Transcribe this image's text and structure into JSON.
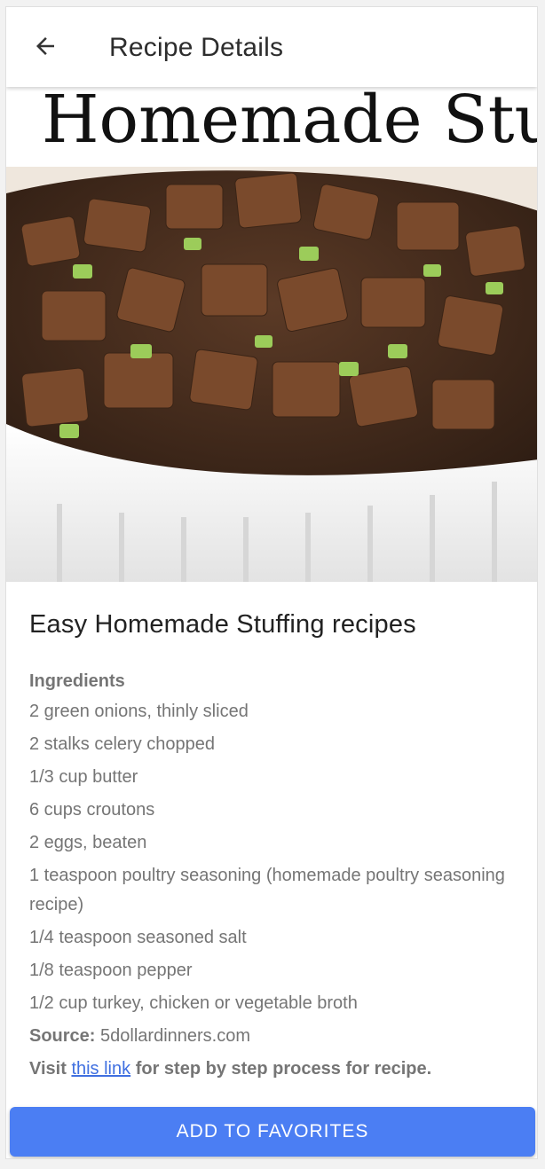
{
  "appbar": {
    "title": "Recipe Details",
    "back_icon": "arrow-left-icon"
  },
  "hero_image": {
    "overlay_text": "Homemade Stu",
    "description_colors": {
      "bread": "#6b4026",
      "celery": "#9ccc5a",
      "dish": "#f5f5f5"
    }
  },
  "recipe": {
    "title": "Easy Homemade Stuffing recipes",
    "ingredients_label": "Ingredients",
    "ingredients": [
      "2 green onions, thinly sliced",
      "2 stalks celery chopped",
      "1/3 cup butter",
      "6 cups croutons",
      "2 eggs, beaten",
      "1 teaspoon poultry seasoning (homemade poultry seasoning recipe)",
      "1/4 teaspoon seasoned salt",
      "1/8 teaspoon pepper",
      "1/2 cup turkey, chicken or vegetable broth"
    ],
    "source_label": "Source:",
    "source_value": "5dollardinners.com",
    "visit_prefix": "Visit",
    "visit_link": "this link",
    "visit_suffix": "for step by step process for recipe."
  },
  "actions": {
    "add_favorites": "ADD TO FAVORITES"
  },
  "colors": {
    "accent": "#4b7ef3",
    "link": "#3f6fe0",
    "text_secondary": "#757575",
    "text_primary": "#222222"
  }
}
